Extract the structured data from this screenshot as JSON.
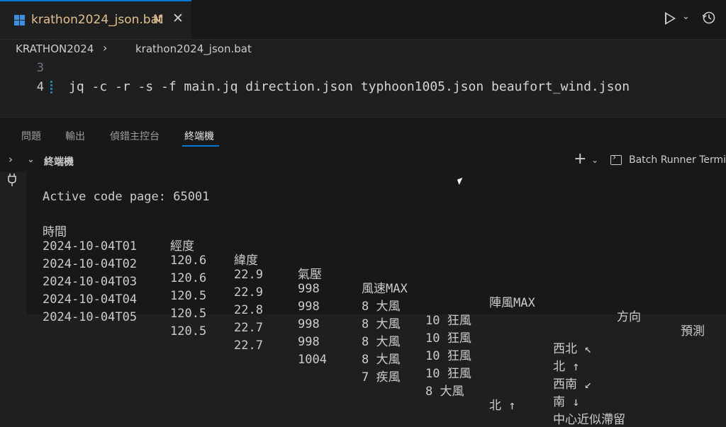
{
  "tab": {
    "filename": "krathon2024_json.bat",
    "modified": "M",
    "close": "✕",
    "file_icon": "windows-icon"
  },
  "actions": {
    "run": "run-icon",
    "run_menu": "⌄",
    "history": "history-icon"
  },
  "breadcrumb": {
    "root": "KRATHON2024",
    "separator": "›",
    "file": "krathon2024_json.bat"
  },
  "editor": {
    "lines": [
      {
        "number": "3",
        "text": ""
      },
      {
        "number": "4",
        "text": "jq -c -r -s -f main.jq direction.json typhoon1005.json beaufort_wind.json"
      }
    ]
  },
  "panel": {
    "tabs": [
      "問題",
      "輸出",
      "偵錯主控台",
      "終端機"
    ],
    "active_tab": "終端機"
  },
  "terminal_header": {
    "collapse": "⌄",
    "title": "終端機",
    "add": "+",
    "add_menu": "⌄",
    "profile": "Batch Runner Termina",
    "side_toggle": "›"
  },
  "terminal": {
    "code_page": "Active code page: 65001",
    "headers": [
      "時間",
      "經度",
      "緯度",
      "氣壓",
      "風速MAX",
      "陣風MAX",
      "方向",
      "預測"
    ],
    "rows": [
      [
        "2024-10-04T01",
        "120.6",
        "22.9",
        "998",
        "8 大風",
        "10 狂風",
        "",
        "西北 ↖"
      ],
      [
        "2024-10-04T02",
        "120.6",
        "22.9",
        "998",
        "8 大風",
        "10 狂風",
        "",
        "北 ↑"
      ],
      [
        "2024-10-04T03",
        "120.5",
        "22.8",
        "998",
        "8 大風",
        "10 狂風",
        "",
        "西南 ↙"
      ],
      [
        "2024-10-04T04",
        "120.5",
        "22.7",
        "998",
        "8 大風",
        "10 狂風",
        "",
        "南 ↓"
      ],
      [
        "2024-10-04T05",
        "120.5",
        "22.7",
        "1004",
        "7 疾風",
        "8 大風",
        "北 ↑",
        "中心近似滯留"
      ]
    ]
  },
  "colors": {
    "accent": "#0078d4",
    "modified": "#e2c08d",
    "background": "#1f1f1f",
    "terminal_bg": "#181818"
  }
}
